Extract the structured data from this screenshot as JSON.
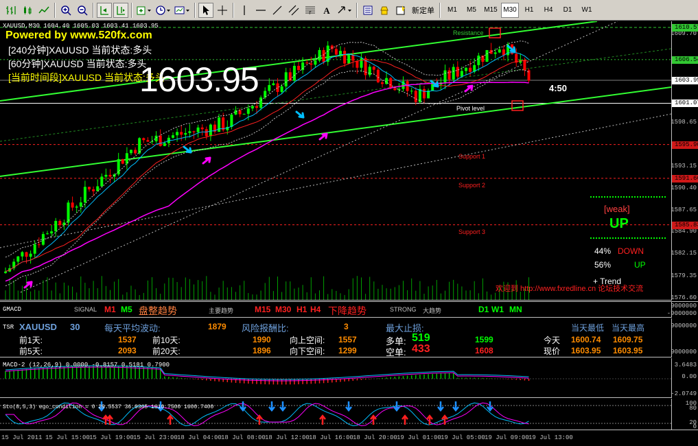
{
  "toolbar": {
    "new_order_label": "新定单",
    "timeframes": [
      "M1",
      "M5",
      "M15",
      "M30",
      "H1",
      "H4",
      "D1",
      "W1"
    ],
    "active_timeframe": "M30"
  },
  "chart": {
    "symbol_header": "XAUUSD,M30   1604.40 1605.03 1603.41 1603.95",
    "powered_by": "Powered by www.520fx.com",
    "status_lines": [
      "[240分钟]XAUUSD 当前状态:多头",
      "[60分钟]XAUUSD 当前状态:多头",
      "[当前时间段]XAUUSD 当前状态:多头"
    ],
    "big_price": "1603.95",
    "countdown": "4:50",
    "levels": {
      "resistance": "Resistance",
      "pivot": "Pivot level",
      "support1": "Support 1",
      "support2": "Support 2",
      "support3": "Support 3"
    },
    "weak_label": "[weak]",
    "up_label": "UP",
    "down_pct": "44%",
    "down_label": "DOWN",
    "up_pct": "56%",
    "up_small": "UP",
    "trend_label": "+  Trend",
    "watermark": "欢迎到 http://www.fxredline.cn 论坛技术交流",
    "price_axis": [
      "1610.57",
      "1609.70",
      "1606.54",
      "1603.95",
      "1601.07",
      "1598.65",
      "1595.90",
      "1593.15",
      "1591.66",
      "1590.40",
      "1587.65",
      "1585.83",
      "1584.90",
      "1582.15",
      "1579.35",
      "1576.60"
    ],
    "highlight": {
      "top": "1610.57",
      "green": "1606.54",
      "current": "1603.95",
      "pivot": "1601.07",
      "red1": "1595.90",
      "red2": "1591.66",
      "red3": "1585.83"
    },
    "colors": {
      "trend": "#32ff32",
      "blue_ma": "#00bfff",
      "magenta_ma": "#ff00ff",
      "red_ma": "#ff2020",
      "bull": "#00ff00",
      "bear": "#ff0000"
    }
  },
  "gmacd": {
    "title": "GMACD",
    "signal": "SIGNAL",
    "tf1": "M1",
    "tf2": "M5",
    "state1": "盘整趋势",
    "label_main": "主要趋势",
    "tf3": "M15",
    "tf4": "M30",
    "tf5": "H1",
    "tf6": "H4",
    "state2": "下降趋势",
    "strong": "STRONG",
    "big_trend": "大趋势",
    "tf7": "D1",
    "tf8": "W1",
    "tf9": "MN",
    "axis_top": "9000000",
    "axis_bottom": "-9000000"
  },
  "tsr": {
    "label": "TSR",
    "symbol": "XAUUSD",
    "period": "30",
    "avg_vol_label": "每天平均波动:",
    "avg_vol": "1879",
    "rr_label": "风险报酬比:",
    "rr": "3",
    "max_sl_label": "最大止损:",
    "day_low_label": "当天最低",
    "day_high_label": "当天最高",
    "prev1_label": "前1天:",
    "prev1": "1537",
    "prev10_label": "前10天:",
    "prev10": "1990",
    "up_space_label": "向上空间:",
    "up_space": "1557",
    "long_label": "多单:",
    "long_val": "519",
    "long_target": "1599",
    "today_label": "今天",
    "today_low": "1600.74",
    "today_high": "1609.75",
    "prev5_label": "前5天:",
    "prev5": "2093",
    "prev20_label": "前20天:",
    "prev20": "1896",
    "down_space_label": "向下空间:",
    "down_space": "1299",
    "short_label": "空单:",
    "short_val": "433",
    "short_target": "1608",
    "now_label": "现价",
    "now1": "1603.95",
    "now2": "1603.95",
    "axis_top": "9000000",
    "axis_bottom": "9000000"
  },
  "macd": {
    "label": "MACD-2 (12,26,9) 0.0000 -0.8157 0.5181 0.7900",
    "axis_top": "3.6483",
    "axis_zero": "0.00",
    "axis_bottom": "-2.0749"
  },
  "stoch": {
    "label": "Sto(8,5,3) ego_condition = 0   29.5537 36.0365 1610.7500 1600.7400",
    "axis_top": "100",
    "axis_80": "80",
    "axis_20": "20",
    "axis_0": "0"
  },
  "time_axis": [
    "15 Jul 2011",
    "15 Jul 15:00",
    "15 Jul 19:00",
    "15 Jul 23:00",
    "18 Jul 04:00",
    "18 Jul 08:00",
    "18 Jul 12:00",
    "18 Jul 16:00",
    "18 Jul 20:00",
    "19 Jul 01:00",
    "19 Jul 05:00",
    "19 Jul 09:00",
    "19 Jul 13:00"
  ]
}
